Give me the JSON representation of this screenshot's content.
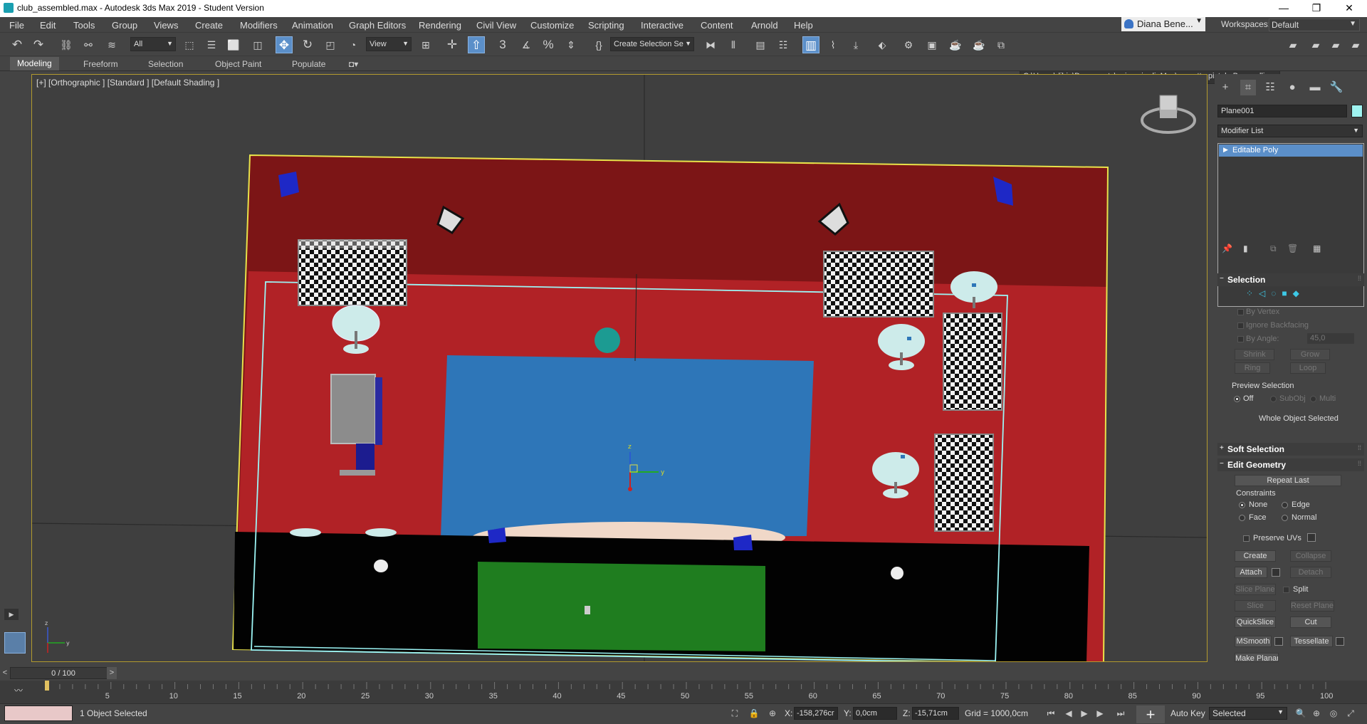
{
  "window": {
    "title": "club_assembled.max - Autodesk 3ds Max 2019 - Student Version",
    "min": "—",
    "max": "❐",
    "close": "✕"
  },
  "menu": [
    "File",
    "Edit",
    "Tools",
    "Group",
    "Views",
    "Create",
    "Modifiers",
    "Animation",
    "Graph Editors",
    "Rendering",
    "Civil View",
    "Customize",
    "Scripting",
    "Interactive",
    "Content",
    "Arnold",
    "Help"
  ],
  "user": {
    "name": "Diana Bene...",
    "dd": "▼"
  },
  "workspaces": {
    "label": "Workspaces:",
    "value": "Default"
  },
  "toolbar": {
    "filter": "All",
    "refcoord": "View",
    "selset": "Create Selection Se",
    "path": "C:\\Users\\djbje\\Documents\\universi...dioMax\\progetto pistola Benevelli",
    "ddarrow": "▼"
  },
  "ribbon": [
    "Modeling",
    "Freeform",
    "Selection",
    "Object Paint",
    "Populate"
  ],
  "viewport": {
    "label": "[+] [Orthographic ] [Standard ] [Default Shading ]"
  },
  "cmdpanel": {
    "object_name": "Plane001",
    "object_color": "#9ff3f0",
    "modifier_list": "Modifier List",
    "stack_item": "Editable Poly",
    "selection": {
      "title": "Selection",
      "by_vertex": "By Vertex",
      "ignore_backfacing": "Ignore Backfacing",
      "by_angle": "By Angle:",
      "angle_val": "45,0",
      "shrink": "Shrink",
      "grow": "Grow",
      "ring": "Ring",
      "loop": "Loop",
      "preview": "Preview Selection",
      "off": "Off",
      "subobj": "SubObj",
      "multi": "Multi",
      "whole": "Whole Object Selected"
    },
    "soft_selection": "Soft Selection",
    "edit_geometry": {
      "title": "Edit Geometry",
      "repeat_last": "Repeat Last",
      "constraints": "Constraints",
      "none": "None",
      "edge": "Edge",
      "face": "Face",
      "normal": "Normal",
      "preserve_uvs": "Preserve UVs",
      "create": "Create",
      "collapse": "Collapse",
      "attach": "Attach",
      "detach": "Detach",
      "slice_plane": "Slice Plane",
      "split": "Split",
      "slice": "Slice",
      "reset_plane": "Reset Plane",
      "quickslice": "QuickSlice",
      "cut": "Cut",
      "msmooth": "MSmooth",
      "tessellate": "Tessellate",
      "make_planar": "Make Planar"
    }
  },
  "timeline": {
    "frame": "0 / 100",
    "prev": "<",
    "next": ">",
    "ticks": [
      "5",
      "10",
      "15",
      "20",
      "25",
      "30",
      "35",
      "40",
      "45",
      "50",
      "55",
      "60",
      "65",
      "70",
      "75",
      "80",
      "85",
      "90",
      "95",
      "100"
    ],
    "curve": "〰"
  },
  "status": {
    "message": "1 Object Selected",
    "x_label": "X:",
    "x": "-158,276cr",
    "y_label": "Y:",
    "y": "0,0cm",
    "z_label": "Z:",
    "z": "-15,71cm",
    "grid": "Grid = 1000,0cm",
    "autokey": "Auto Key",
    "selected": "Selected",
    "plus": "+"
  }
}
